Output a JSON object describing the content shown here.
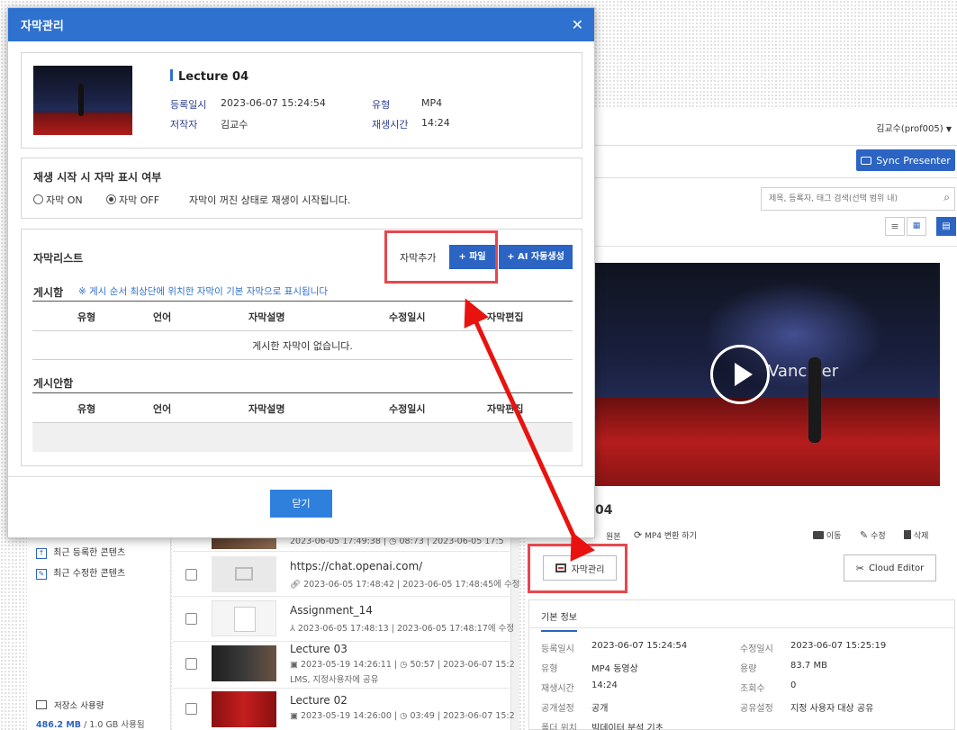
{
  "modal": {
    "title": "자막관리",
    "lecture": {
      "name": "Lecture 04",
      "registered_label": "등록일시",
      "registered_value": "2023-06-07 15:24:54",
      "type_label": "유형",
      "type_value": "MP4",
      "author_label": "저작자",
      "author_value": "김교수",
      "duration_label": "재생시간",
      "duration_value": "14:24"
    },
    "playback": {
      "heading": "재생 시작 시 자막 표시 여부",
      "option_on": "자막 ON",
      "option_off": "자막 OFF",
      "note": "자막이 꺼진 상태로 재생이 시작됩니다."
    },
    "subtitle_list": {
      "heading": "자막리스트",
      "add_label": "자막추가",
      "file_button": "+ 파일",
      "ai_button": "+ AI 자동생성",
      "posted_label": "게시함",
      "posted_note": "※ 게시 순서 최상단에 위치한 자막이 기본 자막으로 표시됩니다",
      "columns": [
        "유형",
        "언어",
        "자막설명",
        "수정일시",
        "자막편집"
      ],
      "posted_empty": "게시한 자막이 없습니다.",
      "unposted_label": "게시안함"
    },
    "close_button": "닫기"
  },
  "app": {
    "user": "김교수(prof005)",
    "sync_button": "Sync Presenter",
    "search_placeholder": "제목, 등록자, 태그 검색(선택 범위 내)",
    "sidebar": {
      "recent_registered": "최근 등록한 콘텐츠",
      "recent_modified": "최근 수정한 콘텐츠",
      "storage_label": "저장소 사용량",
      "storage_used": "486.2 MB",
      "storage_total": "/ 1.0 GB 사용됨"
    },
    "list": [
      {
        "title": "",
        "meta": "2023-06-05 17:49:38  |  ◷ 08:73  |  2023-06-05 17:5"
      },
      {
        "title": "https://chat.openai.com/",
        "meta": "2023-06-05 17:48:42  |  2023-06-05 17:48:45에 수정"
      },
      {
        "title": "Assignment_14",
        "meta": "2023-06-05 17:48:13  |  2023-06-05 17:48:17에 수정"
      },
      {
        "title": "Lecture 03",
        "meta": "2023-05-19 14:26:11  |  ◷ 50:57  |  2023-06-07 15:2",
        "meta2": "LMS, 지정사용자에 공유"
      },
      {
        "title": "Lecture 02",
        "meta": "2023-05-19 14:26:00  |  ◷ 03:49  |  2023-06-07 15:2"
      }
    ],
    "detail": {
      "title_fragment": "04",
      "action_original": "원본",
      "action_convert": "MP4 변환 하기",
      "action_move": "이동",
      "action_edit": "수정",
      "action_delete": "삭제",
      "subtitle_button": "자막관리",
      "cloud_editor": "Cloud Editor",
      "basic_info_tab": "기본 정보",
      "info": {
        "registered_label": "등록일시",
        "registered_value": "2023-06-07 15:24:54",
        "modified_label": "수정일시",
        "modified_value": "2023-06-07 15:25:19",
        "type_label": "유형",
        "type_value": "MP4 동영상",
        "size_label": "용량",
        "size_value": "83.7 MB",
        "duration_label": "재생시간",
        "duration_value": "14:24",
        "views_label": "조회수",
        "views_value": "0",
        "public_label": "공개설정",
        "public_value": "공개",
        "share_label": "공유설정",
        "share_value": "지정 사용자 대상 공유",
        "folder_label": "폴더 위치",
        "folder_value": "빅데이터 분석 기초"
      }
    }
  },
  "colors": {
    "accent": "#2f71cf",
    "button": "#2b64c3",
    "annotation": "#e8464d"
  }
}
